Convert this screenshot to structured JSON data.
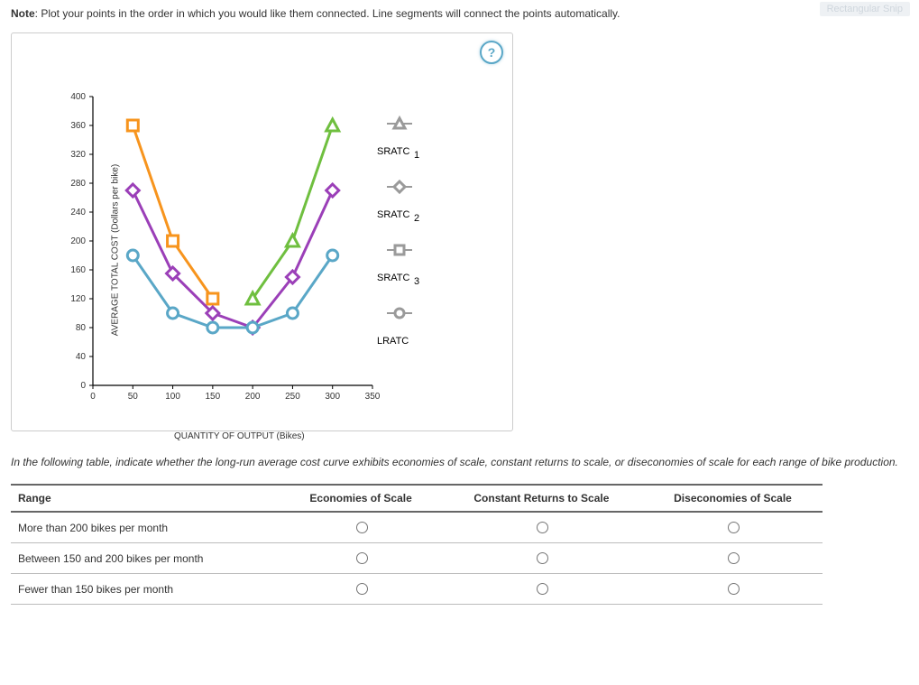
{
  "snip_badge": "Rectangular Snip",
  "note_prefix": "Note",
  "note_text": ": Plot your points in the order in which you would like them connected. Line segments will connect the points automatically.",
  "help_symbol": "?",
  "chart_data": {
    "type": "line",
    "xlabel": "QUANTITY OF OUTPUT (Bikes)",
    "ylabel": "AVERAGE TOTAL COST (Dollars per bike)",
    "xlim": [
      0,
      350
    ],
    "ylim": [
      0,
      400
    ],
    "x_ticks": [
      0,
      50,
      100,
      150,
      200,
      250,
      300,
      350
    ],
    "y_ticks": [
      0,
      40,
      80,
      120,
      160,
      200,
      240,
      280,
      320,
      360,
      400
    ],
    "series": [
      {
        "name": "SRATC1",
        "color": "#f7941d",
        "marker": "square",
        "x": [
          50,
          100,
          150
        ],
        "y": [
          360,
          200,
          120
        ]
      },
      {
        "name": "SRATC2",
        "color": "#9b3fb8",
        "marker": "diamond",
        "x": [
          50,
          100,
          150,
          200,
          250,
          300
        ],
        "y": [
          270,
          155,
          100,
          80,
          150,
          270
        ]
      },
      {
        "name": "SRATC3",
        "color": "#6fbf3f",
        "marker": "triangle",
        "x": [
          200,
          250,
          300
        ],
        "y": [
          120,
          200,
          360
        ]
      },
      {
        "name": "LRATC",
        "color": "#5aa7c7",
        "marker": "circle",
        "x": [
          50,
          100,
          150,
          200,
          250,
          300
        ],
        "y": [
          180,
          100,
          80,
          80,
          100,
          180
        ]
      }
    ],
    "legend": [
      {
        "label": "SRATC",
        "sub": "1",
        "marker": "triangle_gray"
      },
      {
        "label": "SRATC",
        "sub": "2",
        "marker": "diamond_gray"
      },
      {
        "label": "SRATC",
        "sub": "3",
        "marker": "square_gray"
      },
      {
        "label": "LRATC",
        "sub": "",
        "marker": "circle_gray"
      }
    ]
  },
  "question_text": "In the following table, indicate whether the long-run average cost curve exhibits economies of scale, constant returns to scale, or diseconomies of scale for each range of bike production.",
  "table": {
    "headers": [
      "Range",
      "Economies of Scale",
      "Constant Returns to Scale",
      "Diseconomies of Scale"
    ],
    "rows": [
      "More than 200 bikes per month",
      "Between 150 and 200 bikes per month",
      "Fewer than 150 bikes per month"
    ]
  }
}
